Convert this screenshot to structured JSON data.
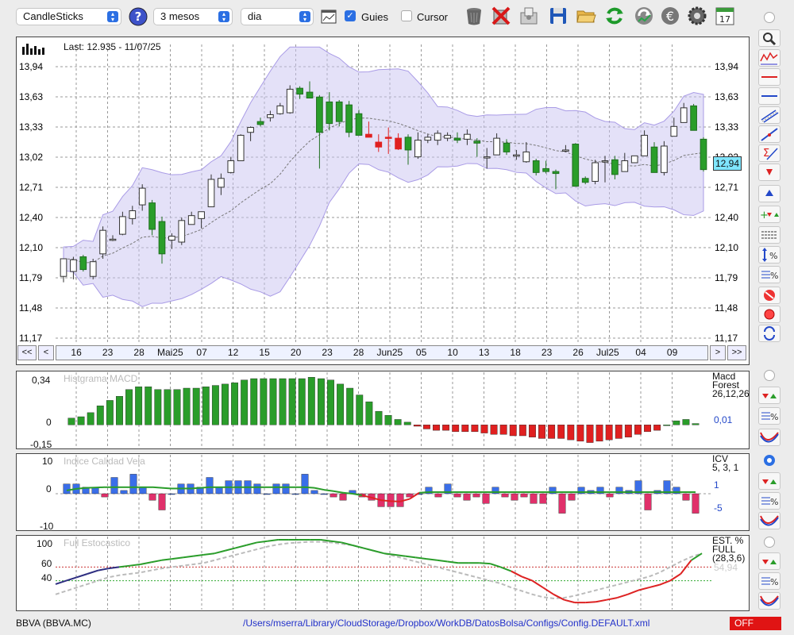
{
  "toolbar": {
    "chart_type": "CandleSticks",
    "period": "3 mesos",
    "interval": "dia",
    "guides_label": "Guies",
    "guides_checked": true,
    "cursor_label": "Cursor",
    "cursor_checked": false,
    "calendar_day": "17"
  },
  "main_chart": {
    "last_label": "Last: 12.935 - 11/07/25",
    "price_tag": "12,94",
    "y_ticks": [
      "13,94",
      "13,63",
      "13,33",
      "13,02",
      "12,71",
      "12,40",
      "12,10",
      "11,79",
      "11,48",
      "11,17"
    ],
    "x_ticks": [
      "16",
      "23",
      "28",
      "Mai25",
      "07",
      "12",
      "15",
      "20",
      "23",
      "28",
      "Jun25",
      "05",
      "10",
      "13",
      "18",
      "23",
      "26",
      "Jul25",
      "04",
      "09"
    ],
    "nav_first": "<<",
    "nav_prev": "<",
    "nav_next": ">",
    "nav_last": ">>"
  },
  "macd_panel": {
    "title": "Histgrama MACD",
    "y_ticks": [
      "0,34",
      "0",
      "-0,15"
    ],
    "legend_line1": "Macd",
    "legend_line2": "Forest",
    "legend_params": "26,12,26",
    "legend_value": "0,01"
  },
  "icv_panel": {
    "title": "Indice Calidad Vela",
    "y_ticks": [
      "10",
      "0",
      "-10"
    ],
    "legend_name": "ICV",
    "legend_params": "5, 3, 1",
    "legend_value_1": "1",
    "legend_value_2": "-5"
  },
  "stoch_panel": {
    "title": "Full Estocastico",
    "y_ticks": [
      "100",
      "60",
      "40"
    ],
    "legend_line1": "EST. %",
    "legend_line2": "FULL",
    "legend_params": "(28,3,6)",
    "legend_value": "54,94"
  },
  "status_bar": {
    "ticker": "BBVA (BBVA.MC)",
    "config_path": "/Users/mserra/Library/CloudStorage/Dropbox/WorkDB/DatosBolsa/Configs/Config.DEFAULT.xml",
    "off_badge": "OFF"
  },
  "colors": {
    "accent": "#2b6fe3",
    "bull_candle": "#2a9d2a",
    "bear_candle": "#e02020",
    "band_fill": "#c9c3f2",
    "macd_pos": "#2a9d2a",
    "macd_neg": "#e02020",
    "icv_pos": "#3a6ee8",
    "icv_neg": "#e0306a"
  },
  "icons": [
    "help-icon",
    "trash-icon",
    "delete-icon",
    "export-icon",
    "save-icon",
    "open-folder-icon",
    "refresh-icon",
    "sync-icon",
    "currency-icon",
    "gear-icon",
    "calendar-icon"
  ],
  "chart_data": [
    {
      "type": "candlestick",
      "title": "",
      "ylim": [
        11.17,
        13.94
      ],
      "x_labels": [
        "16",
        "23",
        "28",
        "Mai25",
        "07",
        "12",
        "15",
        "20",
        "23",
        "28",
        "Jun25",
        "05",
        "10",
        "13",
        "18",
        "23",
        "26",
        "Jul25",
        "04",
        "09"
      ],
      "candles": [
        {
          "o": 11.8,
          "h": 11.93,
          "l": 11.74,
          "c": 11.98
        },
        {
          "o": 11.85,
          "h": 12.0,
          "l": 11.77,
          "c": 11.97
        },
        {
          "o": 12.0,
          "h": 12.02,
          "l": 11.85,
          "c": 11.87
        },
        {
          "o": 11.8,
          "h": 11.98,
          "l": 11.77,
          "c": 11.95
        },
        {
          "o": 12.03,
          "h": 12.31,
          "l": 11.98,
          "c": 12.27
        },
        {
          "o": 12.18,
          "h": 12.22,
          "l": 12.16,
          "c": 12.18
        },
        {
          "o": 12.23,
          "h": 12.46,
          "l": 12.22,
          "c": 12.41
        },
        {
          "o": 12.39,
          "h": 12.52,
          "l": 12.33,
          "c": 12.47
        },
        {
          "o": 12.53,
          "h": 12.74,
          "l": 12.47,
          "c": 12.7
        },
        {
          "o": 12.55,
          "h": 12.58,
          "l": 12.22,
          "c": 12.28
        },
        {
          "o": 12.36,
          "h": 12.41,
          "l": 11.93,
          "c": 12.03
        },
        {
          "o": 12.17,
          "h": 12.24,
          "l": 12.08,
          "c": 12.21
        },
        {
          "o": 12.15,
          "h": 12.4,
          "l": 12.12,
          "c": 12.37
        },
        {
          "o": 12.33,
          "h": 12.46,
          "l": 12.34,
          "c": 12.42
        },
        {
          "o": 12.39,
          "h": 12.45,
          "l": 12.29,
          "c": 12.46
        },
        {
          "o": 12.51,
          "h": 12.84,
          "l": 12.51,
          "c": 12.79
        },
        {
          "o": 12.71,
          "h": 12.85,
          "l": 12.63,
          "c": 12.8
        },
        {
          "o": 12.86,
          "h": 13.02,
          "l": 12.85,
          "c": 12.98
        },
        {
          "o": 12.98,
          "h": 13.25,
          "l": 12.98,
          "c": 13.24
        },
        {
          "o": 13.27,
          "h": 13.33,
          "l": 13.18,
          "c": 13.32
        },
        {
          "o": 13.38,
          "h": 13.42,
          "l": 13.33,
          "c": 13.35
        },
        {
          "o": 13.42,
          "h": 13.49,
          "l": 13.38,
          "c": 13.45
        },
        {
          "o": 13.46,
          "h": 13.57,
          "l": 13.45,
          "c": 13.54
        },
        {
          "o": 13.47,
          "h": 13.75,
          "l": 13.46,
          "c": 13.71
        },
        {
          "o": 13.72,
          "h": 13.74,
          "l": 13.61,
          "c": 13.66
        },
        {
          "o": 13.68,
          "h": 13.79,
          "l": 13.62,
          "c": 13.62
        },
        {
          "o": 13.63,
          "h": 13.65,
          "l": 12.9,
          "c": 13.27
        },
        {
          "o": 13.58,
          "h": 13.68,
          "l": 13.29,
          "c": 13.36
        },
        {
          "o": 13.58,
          "h": 13.6,
          "l": 13.33,
          "c": 13.38
        },
        {
          "o": 13.55,
          "h": 13.59,
          "l": 13.22,
          "c": 13.27
        },
        {
          "o": 13.46,
          "h": 13.5,
          "l": 13.24,
          "c": 13.24
        },
        {
          "o": 13.25,
          "h": 13.38,
          "l": 13.22,
          "c": 13.22
        },
        {
          "o": 13.17,
          "h": 13.25,
          "l": 13.07,
          "c": 13.12
        },
        {
          "o": 13.22,
          "h": 13.32,
          "l": 13.05,
          "c": 13.21
        },
        {
          "o": 13.21,
          "h": 13.26,
          "l": 13.09,
          "c": 13.1
        },
        {
          "o": 13.22,
          "h": 13.25,
          "l": 12.94,
          "c": 13.09
        },
        {
          "o": 13.02,
          "h": 13.27,
          "l": 13.0,
          "c": 13.19
        },
        {
          "o": 13.19,
          "h": 13.25,
          "l": 13.16,
          "c": 13.22
        },
        {
          "o": 13.19,
          "h": 13.29,
          "l": 13.14,
          "c": 13.26
        },
        {
          "o": 13.21,
          "h": 13.27,
          "l": 13.18,
          "c": 13.24
        },
        {
          "o": 13.21,
          "h": 13.27,
          "l": 13.16,
          "c": 13.19
        },
        {
          "o": 13.2,
          "h": 13.3,
          "l": 13.14,
          "c": 13.25
        },
        {
          "o": 13.18,
          "h": 13.21,
          "l": 13.02,
          "c": 13.16
        },
        {
          "o": 13.01,
          "h": 13.11,
          "l": 12.9,
          "c": 13.02
        },
        {
          "o": 13.04,
          "h": 13.26,
          "l": 13.05,
          "c": 13.21
        },
        {
          "o": 13.16,
          "h": 13.2,
          "l": 13.04,
          "c": 13.07
        },
        {
          "o": 13.04,
          "h": 13.09,
          "l": 12.99,
          "c": 13.04
        },
        {
          "o": 12.97,
          "h": 13.17,
          "l": 12.96,
          "c": 13.07
        },
        {
          "o": 12.98,
          "h": 13.0,
          "l": 12.83,
          "c": 12.86
        },
        {
          "o": 12.9,
          "h": 12.98,
          "l": 12.85,
          "c": 12.87
        },
        {
          "o": 12.87,
          "h": 12.89,
          "l": 12.69,
          "c": 12.85
        },
        {
          "o": 13.09,
          "h": 13.14,
          "l": 13.07,
          "c": 13.09
        },
        {
          "o": 13.15,
          "h": 13.16,
          "l": 12.72,
          "c": 12.72
        },
        {
          "o": 12.8,
          "h": 12.82,
          "l": 12.74,
          "c": 12.76
        },
        {
          "o": 12.77,
          "h": 12.99,
          "l": 12.74,
          "c": 12.96
        },
        {
          "o": 12.97,
          "h": 13.03,
          "l": 12.76,
          "c": 12.98
        },
        {
          "o": 12.99,
          "h": 13.03,
          "l": 12.79,
          "c": 12.84
        },
        {
          "o": 12.87,
          "h": 13.06,
          "l": 12.87,
          "c": 12.98
        },
        {
          "o": 12.96,
          "h": 12.99,
          "l": 12.96,
          "c": 13.03
        },
        {
          "o": 13.03,
          "h": 13.29,
          "l": 13.03,
          "c": 13.24
        },
        {
          "o": 13.12,
          "h": 13.17,
          "l": 12.86,
          "c": 12.86
        },
        {
          "o": 12.86,
          "h": 13.18,
          "l": 12.83,
          "c": 13.13
        },
        {
          "o": 13.23,
          "h": 13.42,
          "l": 13.23,
          "c": 13.33
        },
        {
          "o": 13.37,
          "h": 13.57,
          "l": 13.39,
          "c": 13.52
        },
        {
          "o": 13.54,
          "h": 13.56,
          "l": 13.3,
          "c": 13.29
        },
        {
          "o": 13.2,
          "h": 13.22,
          "l": 12.87,
          "c": 12.89
        }
      ]
    },
    {
      "type": "bar",
      "title": "Histgrama MACD",
      "ylim": [
        -0.15,
        0.34
      ],
      "values": [
        0.05,
        0.06,
        0.09,
        0.14,
        0.18,
        0.21,
        0.26,
        0.28,
        0.28,
        0.26,
        0.26,
        0.26,
        0.27,
        0.27,
        0.28,
        0.29,
        0.3,
        0.31,
        0.33,
        0.34,
        0.34,
        0.34,
        0.34,
        0.34,
        0.34,
        0.35,
        0.34,
        0.33,
        0.3,
        0.27,
        0.22,
        0.17,
        0.1,
        0.07,
        0.04,
        0.02,
        -0.01,
        -0.03,
        -0.04,
        -0.04,
        -0.05,
        -0.05,
        -0.05,
        -0.06,
        -0.07,
        -0.07,
        -0.08,
        -0.08,
        -0.09,
        -0.1,
        -0.1,
        -0.1,
        -0.11,
        -0.12,
        -0.13,
        -0.12,
        -0.11,
        -0.1,
        -0.09,
        -0.07,
        -0.05,
        -0.04,
        0.0,
        0.03,
        0.04,
        0.01
      ]
    },
    {
      "type": "bar",
      "title": "Indice Calidad Vela",
      "ylim": [
        -10,
        10
      ],
      "values": [
        3,
        3,
        2,
        2,
        -1,
        5,
        1,
        6,
        2,
        -2,
        -5,
        0,
        3,
        3,
        2,
        5,
        2,
        4,
        4,
        4,
        3,
        0,
        3,
        3,
        0,
        6,
        1,
        0,
        -1,
        -2,
        1,
        -1,
        -2,
        -4,
        -4,
        -4,
        -1,
        0,
        2,
        -1,
        3,
        -1,
        -2,
        -1,
        -3,
        2,
        -1,
        -2,
        -1,
        -3,
        -3,
        2,
        -6,
        -2,
        2,
        1,
        2,
        -1,
        2,
        1,
        4,
        -5,
        1,
        4,
        2,
        -2,
        -6
      ],
      "signal_line": [
        1,
        1.5,
        1.8,
        1.9,
        2,
        2,
        2,
        2,
        2,
        2,
        1.8,
        1.6,
        1.6,
        1.6,
        1.8,
        2,
        2,
        2,
        2,
        2,
        2,
        2,
        2,
        2,
        2,
        2,
        1.8,
        1.2,
        0.8,
        0.3,
        0,
        -0.5,
        -1.2,
        -2,
        -2.3,
        -2.4,
        -1.6,
        0.3,
        0.5,
        0.5,
        0.5,
        0.5,
        0.5,
        0.5,
        0.5,
        0.5,
        0.5,
        0.5,
        0.5,
        0.5,
        0.5,
        0.5,
        0.5,
        0.5,
        0.5,
        0.5,
        0.5,
        0.5,
        0.5,
        0.5,
        0.5,
        0.5,
        0.5,
        0.5,
        0.5,
        0.5,
        0.5
      ]
    },
    {
      "type": "line",
      "title": "Full Estocastico",
      "ylim": [
        0,
        100
      ],
      "k_line": [
        35,
        40,
        45,
        50,
        55,
        58,
        60,
        62,
        64,
        67,
        70,
        72,
        74,
        76,
        78,
        80,
        84,
        88,
        92,
        96,
        98,
        100,
        100,
        100,
        100,
        100,
        98,
        96,
        92,
        88,
        84,
        80,
        78,
        76,
        74,
        72,
        70,
        68,
        66,
        66,
        66,
        65,
        60,
        54,
        46,
        40,
        30,
        20,
        12,
        8,
        8,
        9,
        12,
        15,
        20,
        26,
        30,
        34,
        40,
        50,
        70,
        80
      ],
      "d_line": [
        20,
        25,
        30,
        35,
        40,
        45,
        48,
        50,
        52,
        55,
        58,
        60,
        62,
        64,
        66,
        70,
        74,
        78,
        82,
        86,
        90,
        93,
        95,
        96,
        97,
        97,
        96,
        94,
        92,
        88,
        84,
        80,
        76,
        72,
        68,
        64,
        60,
        56,
        52,
        48,
        44,
        40,
        36,
        30,
        25,
        20,
        16,
        14,
        15,
        18,
        22,
        26,
        30,
        34,
        38,
        42,
        46,
        52,
        60,
        68,
        75,
        80
      ]
    }
  ]
}
